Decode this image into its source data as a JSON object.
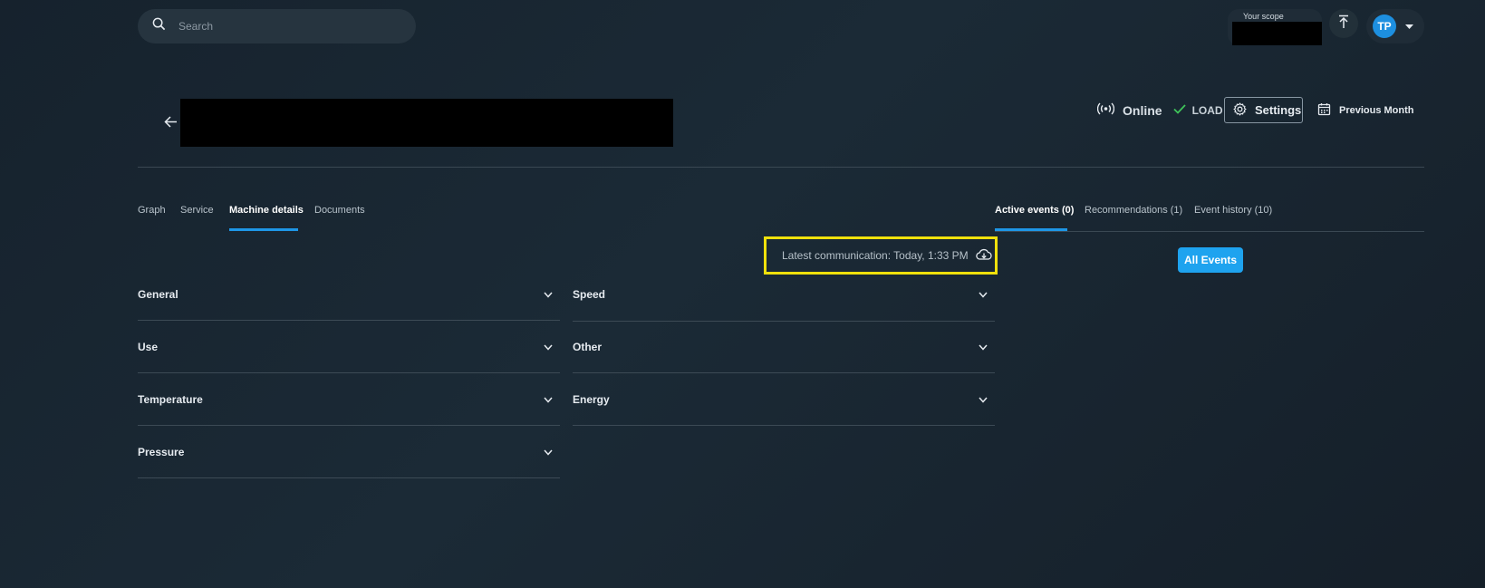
{
  "search": {
    "placeholder": "Search"
  },
  "scope": {
    "label": "Your scope"
  },
  "user": {
    "initials": "TP"
  },
  "status": {
    "online": "Online",
    "load": "LOAD"
  },
  "buttons": {
    "settings": "Settings",
    "period": "Previous Month",
    "all_events": "All Events"
  },
  "tabs_left": [
    "Graph",
    "Service",
    "Machine details",
    "Documents"
  ],
  "tabs_right": [
    "Active events (0)",
    "Recommendations (1)",
    "Event history (10)"
  ],
  "latest_communication": "Latest communication: Today, 1:33 PM",
  "sections_left": [
    "General",
    "Use",
    "Temperature",
    "Pressure"
  ],
  "sections_right": [
    "Speed",
    "Other",
    "Energy"
  ],
  "colors": {
    "accent": "#1e96e6",
    "highlight": "#f0e10c",
    "success": "#3fc45a"
  }
}
